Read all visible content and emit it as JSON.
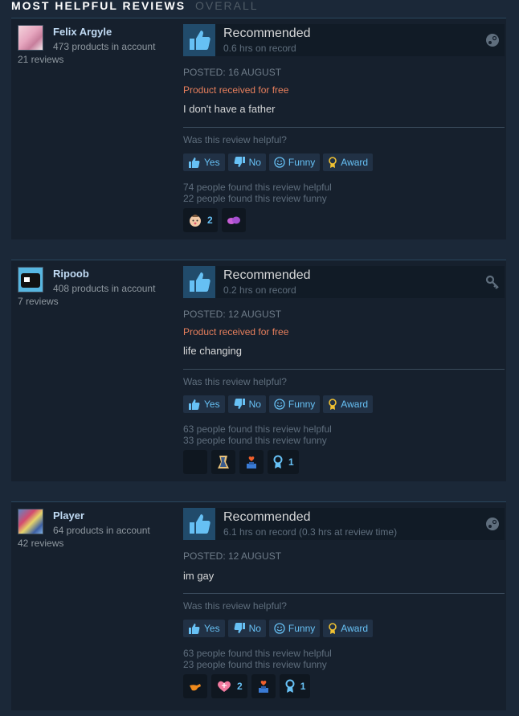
{
  "header": {
    "title": "MOST HELPFUL REVIEWS",
    "subtitle": "OVERALL"
  },
  "helpful_question": "Was this review helpful?",
  "buttons": {
    "yes": "Yes",
    "no": "No",
    "funny": "Funny",
    "award": "Award"
  },
  "reviews": [
    {
      "author": "Felix Argyle",
      "products": "473 products in account",
      "review_count": "21 reviews",
      "recommendation": "Recommended",
      "hours": "0.6 hrs on record",
      "platform_icon": "steam-icon",
      "posted": "POSTED: 16 AUGUST",
      "free_note": "Product received for free",
      "text": "I don't have a father",
      "helpful": "74 people found this review helpful",
      "funny": "22 people found this review funny",
      "awards": [
        {
          "icon": "baby-face-icon",
          "count": "2"
        },
        {
          "icon": "purple-blob-icon",
          "count": ""
        }
      ]
    },
    {
      "author": "Ripoob",
      "products": "408 products in account",
      "review_count": "7 reviews",
      "recommendation": "Recommended",
      "hours": "0.2 hrs on record",
      "platform_icon": "key-icon",
      "posted": "POSTED: 12 AUGUST",
      "free_note": "Product received for free",
      "text": "life changing",
      "helpful": "63 people found this review helpful",
      "funny": "33 people found this review funny",
      "awards": [
        {
          "icon": "blank-award-icon",
          "count": ""
        },
        {
          "icon": "character-award-icon",
          "count": ""
        },
        {
          "icon": "trophy-heart-icon",
          "count": ""
        },
        {
          "icon": "ribbon-award-icon",
          "count": "1"
        }
      ]
    },
    {
      "author": "Player",
      "products": "64 products in account",
      "review_count": "42 reviews",
      "recommendation": "Recommended",
      "hours": "6.1 hrs on record (0.3 hrs at review time)",
      "platform_icon": "steam-icon",
      "posted": "POSTED: 12 AUGUST",
      "free_note": "",
      "text": "im gay",
      "helpful": "63 people found this review helpful",
      "funny": "23 people found this review funny",
      "awards": [
        {
          "icon": "orange-blob-icon",
          "count": ""
        },
        {
          "icon": "heart-award-icon",
          "count": "2"
        },
        {
          "icon": "trophy-heart-icon",
          "count": ""
        },
        {
          "icon": "ribbon-award-icon",
          "count": "1"
        }
      ]
    }
  ],
  "colors": {
    "background": "#1b2838",
    "card": "#16202d",
    "link_blue": "#67c1f5",
    "free_orange": "#e77f5c",
    "thumb_box": "#214b6b"
  }
}
